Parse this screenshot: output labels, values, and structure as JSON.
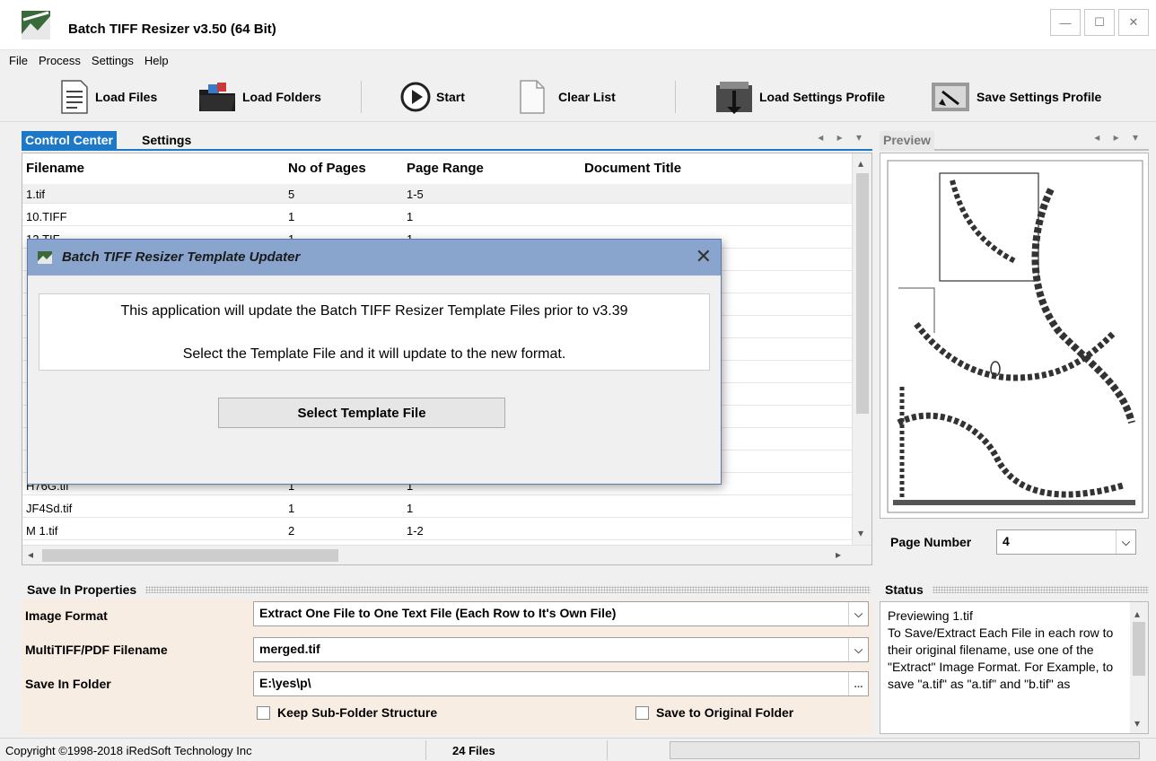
{
  "window": {
    "title": "Batch TIFF Resizer v3.50 (64 Bit)",
    "minimize": "—",
    "maximize": "☐",
    "close": "✕"
  },
  "menu": [
    "File",
    "Process",
    "Settings",
    "Help"
  ],
  "toolbar": {
    "load_files": "Load Files",
    "load_folders": "Load Folders",
    "start": "Start",
    "clear_list": "Clear List",
    "load_settings_profile": "Load Settings Profile",
    "save_settings_profile": "Save Settings Profile"
  },
  "tabs": {
    "control_center": "Control Center",
    "settings": "Settings",
    "preview": "Preview",
    "arrows": "◂ ▸ ▾"
  },
  "grid": {
    "columns": [
      "Filename",
      "No of Pages",
      "Page Range",
      "Document Title"
    ],
    "rows": [
      [
        "1.tif",
        "5",
        "1-5",
        ""
      ],
      [
        "10.TIFF",
        "1",
        "1",
        ""
      ],
      [
        "12.TIF",
        "1",
        "1",
        ""
      ],
      [
        "",
        "",
        "",
        ""
      ],
      [
        "",
        "",
        "",
        ""
      ],
      [
        "",
        "",
        "",
        ""
      ],
      [
        "",
        "",
        "",
        ""
      ],
      [
        "",
        "",
        "",
        ""
      ],
      [
        "",
        "",
        "",
        ""
      ],
      [
        "",
        "",
        "",
        ""
      ],
      [
        "",
        "",
        "",
        ""
      ],
      [
        "",
        "",
        "",
        ""
      ],
      [
        "",
        "",
        "",
        ""
      ],
      [
        "H76G.tif",
        "1",
        "1",
        ""
      ],
      [
        "JF4Sd.tif",
        "1",
        "1",
        ""
      ],
      [
        "M 1.tif",
        "2",
        "1-2",
        ""
      ]
    ]
  },
  "preview": {
    "page_number_label": "Page Number",
    "page_number_value": "4"
  },
  "save_in": {
    "section_title": "Save In Properties",
    "image_format_label": "Image Format",
    "image_format_value": "Extract One File to One Text File (Each Row to It's Own File)",
    "multitiff_label": "MultiTIFF/PDF Filename",
    "multitiff_value": "merged.tif",
    "folder_label": "Save In Folder",
    "folder_value": "E:\\yes\\p\\",
    "browse": "...",
    "keep_subfolder": "Keep Sub-Folder Structure",
    "save_original": "Save to Original Folder"
  },
  "status": {
    "section_title": "Status",
    "text": "Previewing 1.tif\nTo Save/Extract Each File in each row to their original filename, use one of the \"Extract\" Image Format. For Example, to save \"a.tif\" as \"a.tif\" and \"b.tif\" as"
  },
  "statusbar": {
    "copyright": "Copyright ©1998-2018 iRedSoft Technology Inc",
    "file_count": "24 Files"
  },
  "dialog": {
    "title": "Batch TIFF Resizer Template Updater",
    "close": "✕",
    "line1": "This application will update the Batch TIFF Resizer Template Files prior to v3.39",
    "line2": "Select the Template File and it will update to the new format.",
    "button": "Select Template File"
  }
}
